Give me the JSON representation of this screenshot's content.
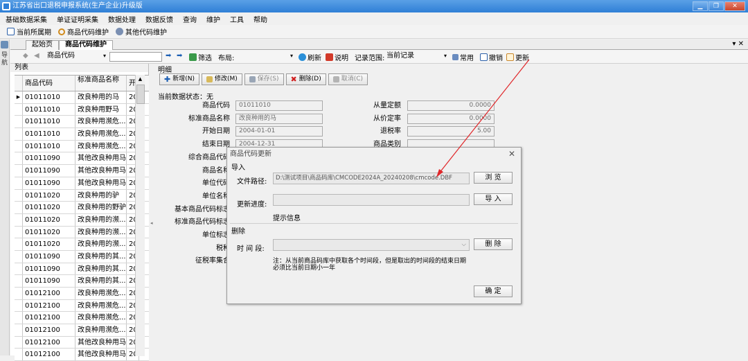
{
  "window": {
    "title": "江苏省出口退税申报系统(生产企业)升级版"
  },
  "menu": [
    "基础数据采集",
    "单证证明采集",
    "数据处理",
    "数据反馈",
    "查询",
    "维护",
    "工具",
    "帮助"
  ],
  "quickbar": [
    "当前所属期",
    "商品代码维护",
    "其他代码维护"
  ],
  "sidebar": {
    "label": "导航"
  },
  "tabs": [
    {
      "label": "起始页"
    },
    {
      "label": "商品代码维护"
    }
  ],
  "toolbar": {
    "search_combo": "商品代码",
    "filter": "筛选",
    "layout_label": "布局:",
    "refresh": "刷新",
    "help": "说明",
    "range_label": "记录范围:",
    "range_value": "当前记录",
    "common": "常用",
    "undo": "撤销",
    "update": "更新"
  },
  "left_panel": {
    "title": "列表",
    "columns": [
      "商品代码",
      "标准商品名称",
      "开"
    ],
    "rows": [
      [
        "01011010",
        "改良种用的马",
        "200"
      ],
      [
        "01011010",
        "改良种用野马",
        "200"
      ],
      [
        "01011010",
        "改良种用濒危...",
        "200"
      ],
      [
        "01011010",
        "改良种用濒危...",
        "200"
      ],
      [
        "01011010",
        "改良种用濒危...",
        "200"
      ],
      [
        "01011090",
        "其他改良种用马",
        "200"
      ],
      [
        "01011090",
        "其他改良种用马",
        "200"
      ],
      [
        "01011090",
        "其他改良种用马",
        "200"
      ],
      [
        "01011020",
        "改良种用的驴",
        "200"
      ],
      [
        "01011020",
        "改良种用的野驴",
        "200"
      ],
      [
        "01011020",
        "改良种用的濒...",
        "200"
      ],
      [
        "01011020",
        "改良种用的濒...",
        "200"
      ],
      [
        "01011020",
        "改良种用的濒...",
        "200"
      ],
      [
        "01011090",
        "改良种用的其...",
        "200"
      ],
      [
        "01011090",
        "改良种用的其...",
        "200"
      ],
      [
        "01011090",
        "改良种用的其...",
        "200"
      ],
      [
        "01012100",
        "改良种用濒危...",
        "201"
      ],
      [
        "01012100",
        "改良种用濒危...",
        "201"
      ],
      [
        "01012100",
        "改良种用濒危...",
        "201"
      ],
      [
        "01012100",
        "改良种用濒危...",
        "201"
      ],
      [
        "01012100",
        "其他改良种用马",
        "201"
      ],
      [
        "01012100",
        "其他改良种用马",
        "201"
      ]
    ]
  },
  "detail": {
    "title": "明细",
    "buttons": [
      "新增(N)",
      "修改(M)",
      "保存(S)",
      "删除(D)",
      "取消(C)"
    ],
    "status": "当前数据状态：无",
    "fields_left": [
      {
        "label": "商品代码",
        "value": "01011010"
      },
      {
        "label": "标准商品名称",
        "value": "改良种用的马"
      },
      {
        "label": "开始日期",
        "value": "2004-01-01"
      },
      {
        "label": "结束日期",
        "value": "2004-12-31"
      },
      {
        "label": "综合商品代码",
        "value": ""
      },
      {
        "label": "商品名称",
        "value": ""
      },
      {
        "label": "单位代码",
        "value": ""
      },
      {
        "label": "单位名称",
        "value": ""
      },
      {
        "label": "基本商品代码标志",
        "value": ""
      },
      {
        "label": "标准商品代码标志",
        "value": ""
      },
      {
        "label": "单位标志",
        "value": ""
      },
      {
        "label": "税种",
        "value": ""
      },
      {
        "label": "征税率集合",
        "value": ""
      }
    ],
    "fields_right": [
      {
        "label": "从量定额",
        "value": "0.0000"
      },
      {
        "label": "从价定率",
        "value": "0.0000"
      },
      {
        "label": "退税率",
        "value": "5.00"
      },
      {
        "label": "商品类别",
        "value": ""
      }
    ]
  },
  "dialog": {
    "title": "商品代码更新",
    "import_section": "导入",
    "file_path_label": "文件路径:",
    "file_path_value": "D:\\测试项目\\商品码库\\CMCODE2024A_20240208\\cmcode.DBF",
    "browse": "浏 览",
    "progress_label": "更新进度:",
    "import_btn": "导 入",
    "info": "提示信息",
    "delete_section": "删除",
    "time_label": "时 间 段:",
    "delete_btn": "删 除",
    "note_line1": "注：从当前商品码库中获取各个时间段，但是取出的时间段的结束日期",
    "note_line2": "必须比当前日期小一年",
    "ok_btn": "确 定"
  },
  "colors": {
    "titlebar": "#2f7fd6",
    "arrow": "#e0282b",
    "accent_blue": "#1c5fb4"
  }
}
